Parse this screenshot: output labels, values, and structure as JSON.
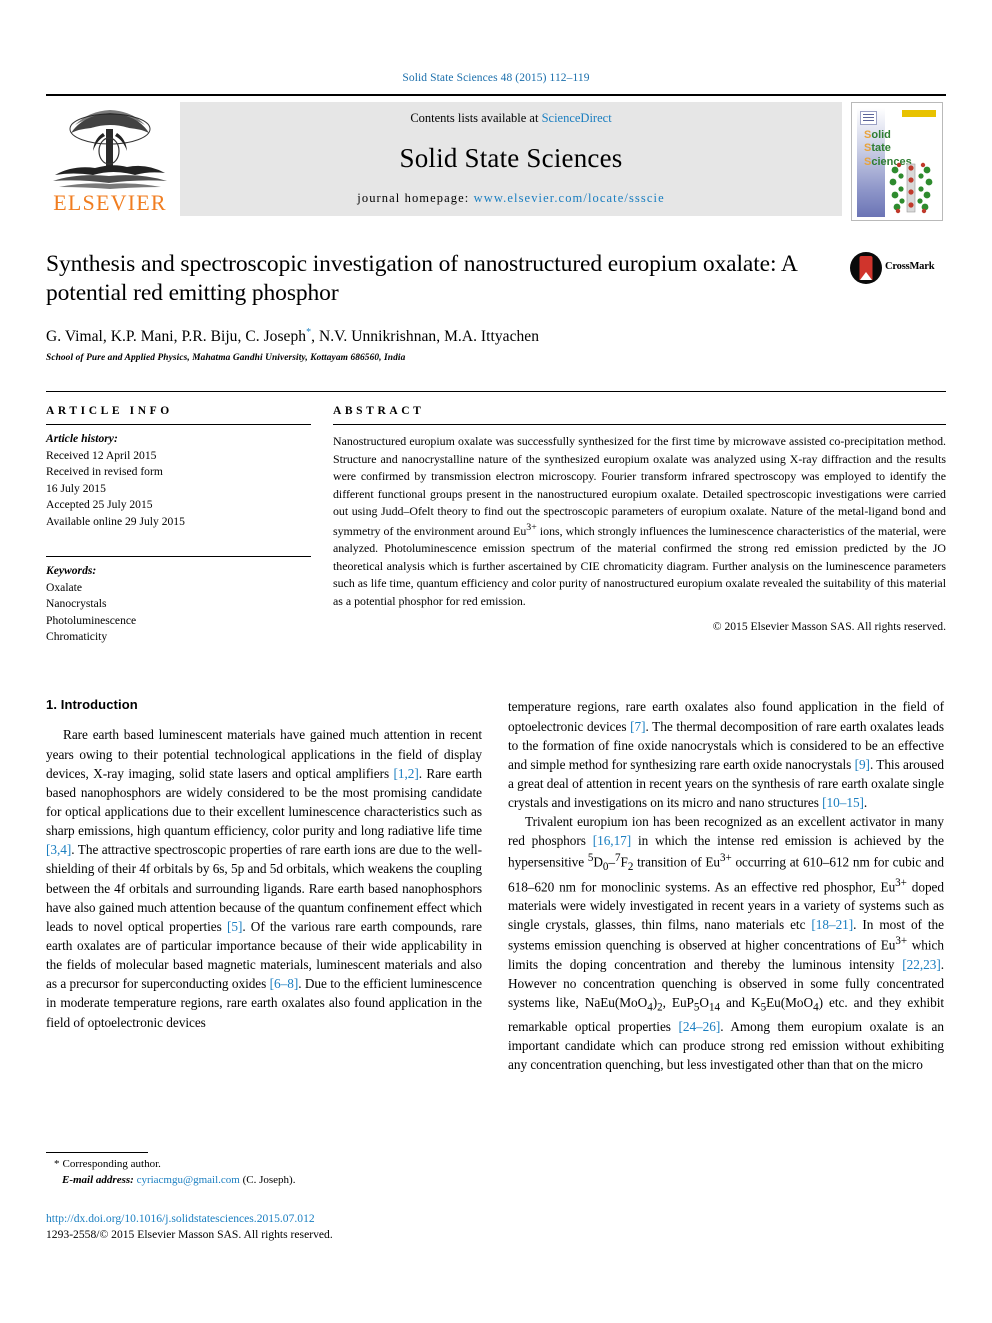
{
  "running_head": "Solid State Sciences 48 (2015) 112–119",
  "masthead": {
    "publisher": "ELSEVIER",
    "contents_prefix": "Contents lists available at ",
    "contents_link": "ScienceDirect",
    "journal_name": "Solid State Sciences",
    "homepage_prefix": "journal homepage: ",
    "homepage_url": "www.elsevier.com/locate/ssscie",
    "cover_title_lines": [
      "Solid",
      "State",
      "Sciences"
    ]
  },
  "article": {
    "title": "Synthesis and spectroscopic investigation of nanostructured europium oxalate: A potential red emitting phosphor",
    "authors": "G. Vimal, K.P. Mani, P.R. Biju, C. Joseph",
    "authors_tail": ", N.V. Unnikrishnan, M.A. Ittyachen",
    "corresponding_marker": "*",
    "affiliation": "School of Pure and Applied Physics, Mahatma Gandhi University, Kottayam 686560, India",
    "crossmark_label": "CrossMark"
  },
  "article_info": {
    "heading": "ARTICLE INFO",
    "history_label": "Article history:",
    "history": [
      "Received 12 April 2015",
      "Received in revised form",
      "16 July 2015",
      "Accepted 25 July 2015",
      "Available online 29 July 2015"
    ],
    "keywords_label": "Keywords:",
    "keywords": [
      "Oxalate",
      "Nanocrystals",
      "Photoluminescence",
      "Chromaticity"
    ]
  },
  "abstract": {
    "heading": "ABSTRACT",
    "part1": "Nanostructured europium oxalate was successfully synthesized for the first time by microwave assisted co-precipitation method. Structure and nanocrystalline nature of the synthesized europium oxalate was analyzed using X-ray diffraction and the results were confirmed by transmission electron microscopy. Fourier transform infrared spectroscopy was employed to identify the different functional groups present in the nanostructured europium oxalate. Detailed spectroscopic investigations were carried out using Judd–Ofelt theory to find out the spectroscopic parameters of europium oxalate. Nature of the metal-ligand bond and symmetry of the environment around Eu",
    "sup1": "3+",
    "part2": " ions, which strongly influences the luminescence characteristics of the material, were analyzed. Photoluminescence emission spectrum of the material confirmed the strong red emission predicted by the JO theoretical analysis which is further ascertained by CIE chromaticity diagram. Further analysis on the luminescence parameters such as life time, quantum efficiency and color purity of nanostructured europium oxalate revealed the suitability of this material as a potential phosphor for red emission.",
    "copyright": "© 2015 Elsevier Masson SAS. All rights reserved."
  },
  "introduction": {
    "heading": "1. Introduction",
    "left_p1_a": "Rare earth based luminescent materials have gained much attention in recent years owing to their potential technological applications in the field of display devices, X-ray imaging, solid state lasers and optical amplifiers ",
    "ref_1_2": "[1,2]",
    "left_p1_b": ". Rare earth based nanophosphors are widely considered to be the most promising candidate for optical applications due to their excellent luminescence characteristics such as sharp emissions, high quantum efficiency, color purity and long radiative life time ",
    "ref_3_4": "[3,4]",
    "left_p1_c": ". The attractive spectroscopic properties of rare earth ions are due to the well-shielding of their 4f orbitals by 6s, 5p and 5d orbitals, which weakens the coupling between the 4f orbitals and surrounding ligands. Rare earth based nanophosphors have also gained much attention because of the quantum confinement effect which leads to novel optical properties ",
    "ref_5": "[5]",
    "left_p1_d": ". Of the various rare earth compounds, rare earth oxalates are of particular importance because of their wide applicability in the fields of molecular based magnetic materials, luminescent materials and also as a precursor for superconducting oxides ",
    "ref_6_8": "[6–8]",
    "left_p1_e": ". Due to the efficient luminescence in moderate temperature regions, rare earth oxalates also found application in the field of optoelectronic devices ",
    "ref_7": "[7]",
    "right_p1_a": ". The thermal decomposition of rare earth oxalates leads to the formation of fine oxide nanocrystals which is considered to be an effective and simple method for synthesizing rare earth oxide nanocrystals ",
    "ref_9": "[9]",
    "right_p1_b": ". This aroused a great deal of attention in recent years on the synthesis of rare earth oxalate single crystals and investigations on its micro and nano structures ",
    "ref_10_15": "[10–15]",
    "right_p1_c": ".",
    "right_p2_a": "Trivalent europium ion has been recognized as an excellent activator in many red phosphors ",
    "ref_16_17": "[16,17]",
    "right_p2_b": " in which the intense red emission is achieved by the hypersensitive ",
    "trans_sup1": "5",
    "trans_d": "D",
    "trans_sub1": "0",
    "trans_dash": "–",
    "trans_sup2": "7",
    "trans_f": "F",
    "trans_sub2": "2",
    "right_p2_c": " transition of Eu",
    "eu_sup": "3+",
    "right_p2_d": " occurring at 610–612 nm for cubic and 618–620 nm for monoclinic systems. As an effective red phosphor, Eu",
    "right_p2_e": " doped materials were widely investigated in recent years in a variety of systems such as single crystals, glasses, thin films, nano materials etc ",
    "ref_18_21": "[18–21]",
    "right_p2_f": ". In most of the systems emission quenching is observed at higher concentrations of Eu",
    "right_p2_g": " which limits the doping concentration and thereby the luminous intensity ",
    "ref_22_23": "[22,23]",
    "right_p2_h": ". However no concentration quenching is observed in some fully concentrated systems like, NaEu(MoO",
    "sub4a": "4",
    "right_p2_i": ")",
    "sub2a": "2",
    "right_p2_j": ", EuP",
    "sub5": "5",
    "right_p2_k": "O",
    "sub14": "14",
    "right_p2_l": " and K",
    "sub5b": "5",
    "right_p2_m": "Eu(MoO",
    "sub4b": "4",
    "right_p2_n": ") etc. and they exhibit remarkable optical properties ",
    "ref_24_26": "[24–26]",
    "right_p2_o": ". Among them europium oxalate is an important candidate which can produce strong red emission without exhibiting any concentration quenching, but less investigated other than that on the micro"
  },
  "footer": {
    "corresponding_star": "*",
    "corresponding_label": "Corresponding author.",
    "email_label": "E-mail address:",
    "email": "cyriacmgu@gmail.com",
    "email_owner": "(C. Joseph).",
    "doi": "http://dx.doi.org/10.1016/j.solidstatesciences.2015.07.012",
    "issn_line": "1293-2558/© 2015 Elsevier Masson SAS. All rights reserved."
  },
  "colors": {
    "link": "#1a7ec0",
    "elsevier_orange": "#f07d20",
    "band_gray": "#e6e6e6"
  }
}
